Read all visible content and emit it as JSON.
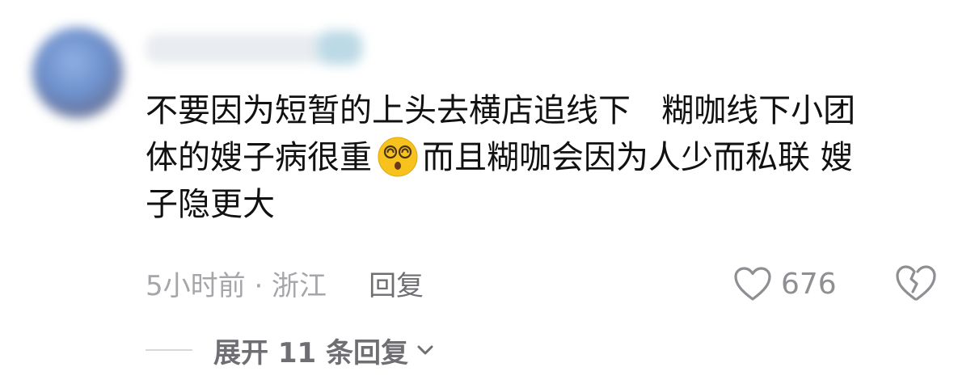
{
  "comment": {
    "lines": [
      "不要因为短暂的上头去横店追线下   糊咖线下小团",
      "体的嫂子病很重",
      "而且糊咖会因为人少而私联 嫂",
      "子隐更大"
    ],
    "emoji_icon": "dizzy-face-emoji"
  },
  "meta": {
    "time_location": "5小时前 · 浙江",
    "reply_label": "回复"
  },
  "likes": {
    "count": "676",
    "icon": "heart-outline-icon"
  },
  "dislike": {
    "icon": "broken-heart-icon"
  },
  "expand": {
    "label": "展开 11 条回复"
  },
  "colors": {
    "text_primary": "#111111",
    "text_secondary": "#a6a6aa",
    "text_action": "#6e6e73",
    "emoji_yellow": "#f7c21e"
  }
}
